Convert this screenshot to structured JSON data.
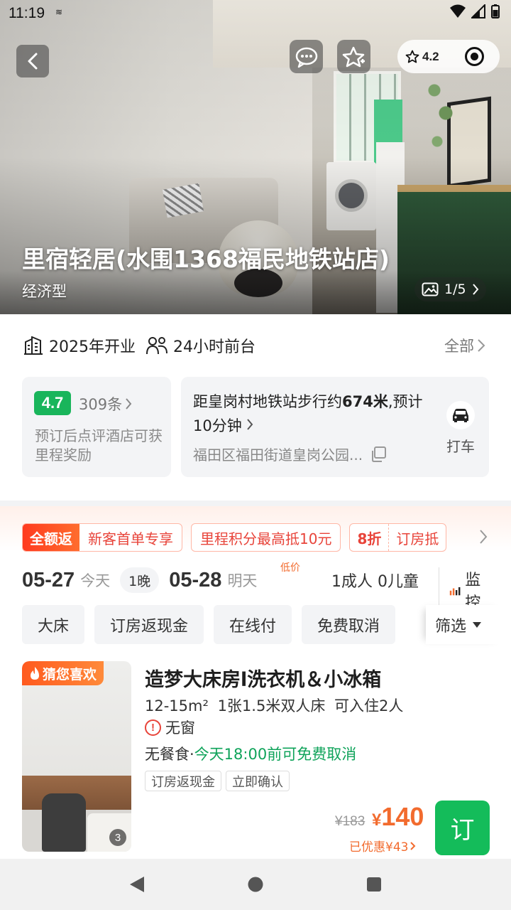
{
  "status_bar": {
    "time": "11:19",
    "sim_icon": "sim-card-icon"
  },
  "header": {
    "rating": "4.2",
    "hotel_name": "里宿轻居(水围1368福民地铁站店)",
    "hotel_type": "经济型",
    "photo_counter": "1/5"
  },
  "features": {
    "opened": "2025年开业",
    "front_desk": "24小时前台",
    "all_label": "全部"
  },
  "review": {
    "score": "4.7",
    "count": "309条",
    "note": "预订后点评酒店可获里程奖励"
  },
  "location": {
    "walk_prefix": "距皇岗村地铁站步行约",
    "walk_distance": "674米",
    "walk_suffix": ",预计10分钟",
    "address": "福田区福田街道皇岗公园...",
    "taxi_label": "打车"
  },
  "promos": {
    "first_hot": "全额返",
    "first_text": "新客首单专享",
    "second": "里程积分最高抵10元",
    "discount": "8折",
    "discount_text": "订房抵"
  },
  "dates": {
    "checkin": "05-27",
    "checkin_day": "今天",
    "nights": "1晚",
    "checkout": "05-28",
    "checkout_day": "明天",
    "low_price_tag": "低价",
    "guests": "1成人  0儿童",
    "monitor": "监控"
  },
  "filters": {
    "chips": [
      "大床",
      "订房返现金",
      "在线付",
      "免费取消"
    ],
    "filter_label": "筛选"
  },
  "room": {
    "badge": "猜您喜欢",
    "image_count": "3",
    "name": "造梦大床房l洗衣机＆小冰箱",
    "spec": "12-15m²  1张1.5米双人床  可入住2人",
    "warning": "无窗",
    "meal": "无餐食·",
    "cancel": "今天18:00前可免费取消",
    "tags": [
      "订房返现金",
      "立即确认"
    ],
    "price_original": "¥183",
    "price_currency": "¥",
    "price_now": "140",
    "saving": "已优惠¥43",
    "book_label": "订"
  },
  "colors": {
    "accent_green": "#14bc5a",
    "price_orange": "#f26b2e",
    "promo_red": "#e8443a",
    "rating_green": "#19b55b"
  }
}
